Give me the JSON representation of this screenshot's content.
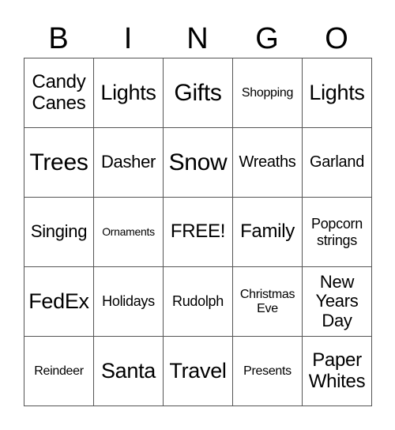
{
  "header": {
    "letters": [
      "B",
      "I",
      "N",
      "G",
      "O"
    ]
  },
  "grid": {
    "cells": [
      [
        "Candy\nCanes",
        "Lights",
        "Gifts",
        "Shopping",
        "Lights"
      ],
      [
        "Trees",
        "Dasher",
        "Snow",
        "Wreaths",
        "Garland"
      ],
      [
        "Singing",
        "Ornaments",
        "FREE!",
        "Family",
        "Popcorn\nstrings"
      ],
      [
        "FedEx",
        "Holidays",
        "Rudolph",
        "Christmas\nEve",
        "New\nYears\nDay"
      ],
      [
        "Reindeer",
        "Santa",
        "Travel",
        "Presents",
        "Paper\nWhites"
      ]
    ]
  }
}
